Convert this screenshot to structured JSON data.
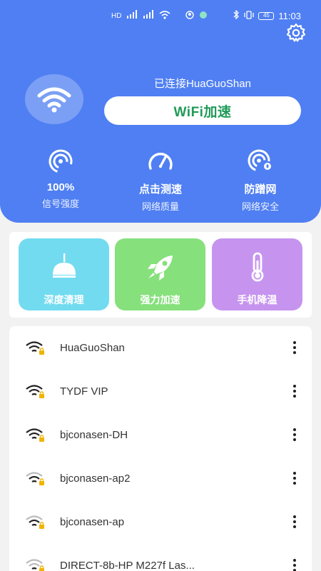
{
  "status_bar": {
    "left_glyphs": [
      "HD",
      "5G",
      "5G",
      "wifi",
      "",
      ""
    ],
    "battery": "45",
    "time": "11:03"
  },
  "header": {
    "connected_text": "已连接HuaGuoShan",
    "boost_button": "WiFi加速"
  },
  "stats": [
    {
      "value": "100%",
      "label": "信号强度",
      "icon": "signal-icon"
    },
    {
      "value": "点击测速",
      "label": "网络质量",
      "icon": "speedometer-icon"
    },
    {
      "value": "防蹭网",
      "label": "网络安全",
      "icon": "security-icon"
    }
  ],
  "tools": [
    {
      "label": "深度清理",
      "color": "#72dbf0",
      "icon": "lamp-icon"
    },
    {
      "label": "强力加速",
      "color": "#86e07c",
      "icon": "rocket-icon"
    },
    {
      "label": "手机降温",
      "color": "#c694ef",
      "icon": "thermometer-icon"
    }
  ],
  "networks": [
    {
      "name": "HuaGuoShan"
    },
    {
      "name": "TYDF VIP"
    },
    {
      "name": "bjconasen-DH"
    },
    {
      "name": "bjconasen-ap2"
    },
    {
      "name": "bjconasen-ap"
    },
    {
      "name": "DIRECT-8b-HP M227f Las..."
    }
  ],
  "colors": {
    "primary": "#4f7ff2",
    "boost_text": "#1f9a57",
    "lock": "#f0b400"
  }
}
